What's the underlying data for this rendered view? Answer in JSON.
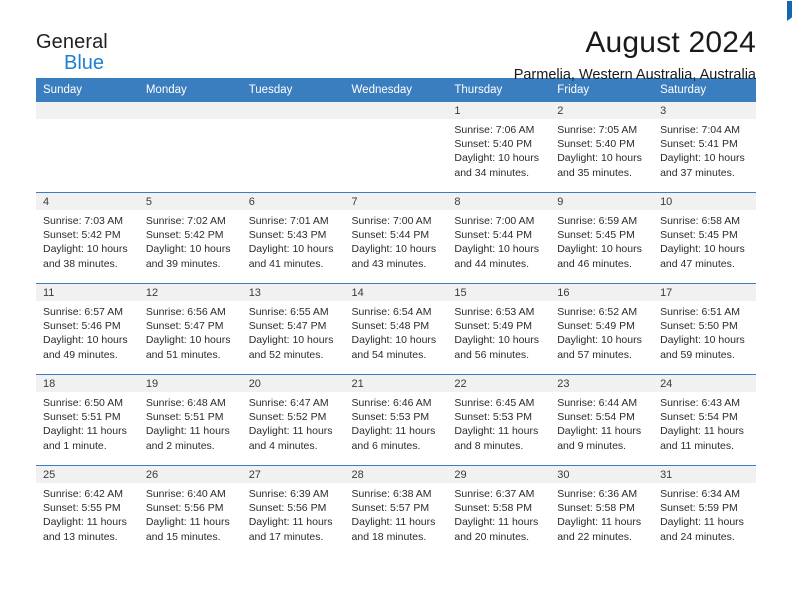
{
  "brand": {
    "line1": "General",
    "line2": "Blue",
    "flag_color": "#1565b0",
    "blue_color": "#1d7fd1"
  },
  "header": {
    "title": "August 2024",
    "subtitle": "Parmelia, Western Australia, Australia"
  },
  "theme": {
    "header_row_bg": "#3a7ec0",
    "daynum_bar_bg": "#f1f1f1",
    "grid_line": "#3a7ec0",
    "text": "#2b2b2b"
  },
  "weekday_headers": [
    "Sunday",
    "Monday",
    "Tuesday",
    "Wednesday",
    "Thursday",
    "Friday",
    "Saturday"
  ],
  "weeks": [
    [
      {
        "day": "",
        "empty": true,
        "sunrise": "",
        "sunset": "",
        "daylight1": "",
        "daylight2": ""
      },
      {
        "day": "",
        "empty": true,
        "sunrise": "",
        "sunset": "",
        "daylight1": "",
        "daylight2": ""
      },
      {
        "day": "",
        "empty": true,
        "sunrise": "",
        "sunset": "",
        "daylight1": "",
        "daylight2": ""
      },
      {
        "day": "",
        "empty": true,
        "sunrise": "",
        "sunset": "",
        "daylight1": "",
        "daylight2": ""
      },
      {
        "day": "1",
        "sunrise": "Sunrise: 7:06 AM",
        "sunset": "Sunset: 5:40 PM",
        "daylight1": "Daylight: 10 hours",
        "daylight2": "and 34 minutes."
      },
      {
        "day": "2",
        "sunrise": "Sunrise: 7:05 AM",
        "sunset": "Sunset: 5:40 PM",
        "daylight1": "Daylight: 10 hours",
        "daylight2": "and 35 minutes."
      },
      {
        "day": "3",
        "sunrise": "Sunrise: 7:04 AM",
        "sunset": "Sunset: 5:41 PM",
        "daylight1": "Daylight: 10 hours",
        "daylight2": "and 37 minutes."
      }
    ],
    [
      {
        "day": "4",
        "sunrise": "Sunrise: 7:03 AM",
        "sunset": "Sunset: 5:42 PM",
        "daylight1": "Daylight: 10 hours",
        "daylight2": "and 38 minutes."
      },
      {
        "day": "5",
        "sunrise": "Sunrise: 7:02 AM",
        "sunset": "Sunset: 5:42 PM",
        "daylight1": "Daylight: 10 hours",
        "daylight2": "and 39 minutes."
      },
      {
        "day": "6",
        "sunrise": "Sunrise: 7:01 AM",
        "sunset": "Sunset: 5:43 PM",
        "daylight1": "Daylight: 10 hours",
        "daylight2": "and 41 minutes."
      },
      {
        "day": "7",
        "sunrise": "Sunrise: 7:00 AM",
        "sunset": "Sunset: 5:44 PM",
        "daylight1": "Daylight: 10 hours",
        "daylight2": "and 43 minutes."
      },
      {
        "day": "8",
        "sunrise": "Sunrise: 7:00 AM",
        "sunset": "Sunset: 5:44 PM",
        "daylight1": "Daylight: 10 hours",
        "daylight2": "and 44 minutes."
      },
      {
        "day": "9",
        "sunrise": "Sunrise: 6:59 AM",
        "sunset": "Sunset: 5:45 PM",
        "daylight1": "Daylight: 10 hours",
        "daylight2": "and 46 minutes."
      },
      {
        "day": "10",
        "sunrise": "Sunrise: 6:58 AM",
        "sunset": "Sunset: 5:45 PM",
        "daylight1": "Daylight: 10 hours",
        "daylight2": "and 47 minutes."
      }
    ],
    [
      {
        "day": "11",
        "sunrise": "Sunrise: 6:57 AM",
        "sunset": "Sunset: 5:46 PM",
        "daylight1": "Daylight: 10 hours",
        "daylight2": "and 49 minutes."
      },
      {
        "day": "12",
        "sunrise": "Sunrise: 6:56 AM",
        "sunset": "Sunset: 5:47 PM",
        "daylight1": "Daylight: 10 hours",
        "daylight2": "and 51 minutes."
      },
      {
        "day": "13",
        "sunrise": "Sunrise: 6:55 AM",
        "sunset": "Sunset: 5:47 PM",
        "daylight1": "Daylight: 10 hours",
        "daylight2": "and 52 minutes."
      },
      {
        "day": "14",
        "sunrise": "Sunrise: 6:54 AM",
        "sunset": "Sunset: 5:48 PM",
        "daylight1": "Daylight: 10 hours",
        "daylight2": "and 54 minutes."
      },
      {
        "day": "15",
        "sunrise": "Sunrise: 6:53 AM",
        "sunset": "Sunset: 5:49 PM",
        "daylight1": "Daylight: 10 hours",
        "daylight2": "and 56 minutes."
      },
      {
        "day": "16",
        "sunrise": "Sunrise: 6:52 AM",
        "sunset": "Sunset: 5:49 PM",
        "daylight1": "Daylight: 10 hours",
        "daylight2": "and 57 minutes."
      },
      {
        "day": "17",
        "sunrise": "Sunrise: 6:51 AM",
        "sunset": "Sunset: 5:50 PM",
        "daylight1": "Daylight: 10 hours",
        "daylight2": "and 59 minutes."
      }
    ],
    [
      {
        "day": "18",
        "sunrise": "Sunrise: 6:50 AM",
        "sunset": "Sunset: 5:51 PM",
        "daylight1": "Daylight: 11 hours",
        "daylight2": "and 1 minute."
      },
      {
        "day": "19",
        "sunrise": "Sunrise: 6:48 AM",
        "sunset": "Sunset: 5:51 PM",
        "daylight1": "Daylight: 11 hours",
        "daylight2": "and 2 minutes."
      },
      {
        "day": "20",
        "sunrise": "Sunrise: 6:47 AM",
        "sunset": "Sunset: 5:52 PM",
        "daylight1": "Daylight: 11 hours",
        "daylight2": "and 4 minutes."
      },
      {
        "day": "21",
        "sunrise": "Sunrise: 6:46 AM",
        "sunset": "Sunset: 5:53 PM",
        "daylight1": "Daylight: 11 hours",
        "daylight2": "and 6 minutes."
      },
      {
        "day": "22",
        "sunrise": "Sunrise: 6:45 AM",
        "sunset": "Sunset: 5:53 PM",
        "daylight1": "Daylight: 11 hours",
        "daylight2": "and 8 minutes."
      },
      {
        "day": "23",
        "sunrise": "Sunrise: 6:44 AM",
        "sunset": "Sunset: 5:54 PM",
        "daylight1": "Daylight: 11 hours",
        "daylight2": "and 9 minutes."
      },
      {
        "day": "24",
        "sunrise": "Sunrise: 6:43 AM",
        "sunset": "Sunset: 5:54 PM",
        "daylight1": "Daylight: 11 hours",
        "daylight2": "and 11 minutes."
      }
    ],
    [
      {
        "day": "25",
        "sunrise": "Sunrise: 6:42 AM",
        "sunset": "Sunset: 5:55 PM",
        "daylight1": "Daylight: 11 hours",
        "daylight2": "and 13 minutes."
      },
      {
        "day": "26",
        "sunrise": "Sunrise: 6:40 AM",
        "sunset": "Sunset: 5:56 PM",
        "daylight1": "Daylight: 11 hours",
        "daylight2": "and 15 minutes."
      },
      {
        "day": "27",
        "sunrise": "Sunrise: 6:39 AM",
        "sunset": "Sunset: 5:56 PM",
        "daylight1": "Daylight: 11 hours",
        "daylight2": "and 17 minutes."
      },
      {
        "day": "28",
        "sunrise": "Sunrise: 6:38 AM",
        "sunset": "Sunset: 5:57 PM",
        "daylight1": "Daylight: 11 hours",
        "daylight2": "and 18 minutes."
      },
      {
        "day": "29",
        "sunrise": "Sunrise: 6:37 AM",
        "sunset": "Sunset: 5:58 PM",
        "daylight1": "Daylight: 11 hours",
        "daylight2": "and 20 minutes."
      },
      {
        "day": "30",
        "sunrise": "Sunrise: 6:36 AM",
        "sunset": "Sunset: 5:58 PM",
        "daylight1": "Daylight: 11 hours",
        "daylight2": "and 22 minutes."
      },
      {
        "day": "31",
        "sunrise": "Sunrise: 6:34 AM",
        "sunset": "Sunset: 5:59 PM",
        "daylight1": "Daylight: 11 hours",
        "daylight2": "and 24 minutes."
      }
    ]
  ]
}
